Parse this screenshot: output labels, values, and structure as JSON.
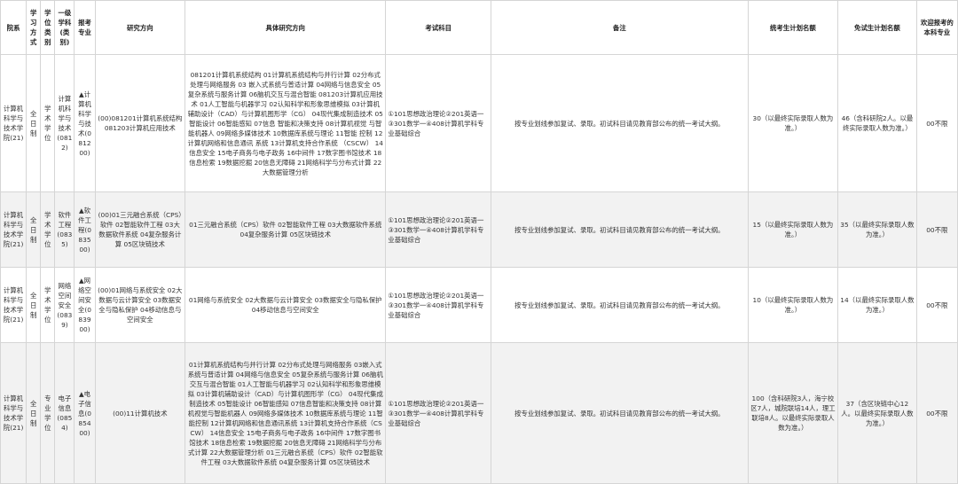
{
  "headers": {
    "dept": "院系",
    "study_mode": "学习方式",
    "degree_type": "学位类别",
    "first_discipline": "一级学科(类别)",
    "major": "报考专业",
    "direction": "研究方向",
    "specific_direction": "具体研究方向",
    "exam_subjects": "考试科目",
    "remarks": "备注",
    "unified_plan": "统考生计划名额",
    "exempt_plan": "免试生计划名额",
    "welcome": "欢迎报考的本科专业"
  },
  "rows": [
    {
      "dept": "计算机科学与技术学院(21)",
      "study_mode": "全日制",
      "degree_type": "学术学位",
      "first_discipline": "计算机科学与技术(0812)",
      "major": "▲计算机科学与技术(081200)",
      "direction": "(00)081201计算机系统结构 081203计算机应用技术",
      "specific_direction": "081201计算机系统结构 01计算机系统结构与并行计算 02分布式处理与网络服务 03 嵌入式系统与普适计算 04网络与信息安全 05复杂系统与服务计算 06脑机交互与混合智能 081203计算机应用技术 01人工智能与机器学习 02认知科学和形象思维模拟 03计算机 辅助设计（CAD）与计算机图形学（CG） 04现代集成制造技术 05智能设计 06智能感知 07信息 智能和决策支持 08计算机视觉 与智能机器人 09网络多媒体技术 10数据库系统与理论 11智能 控制 12计算机网络和信息通讯 系统 13计算机支持合作系统 （CSCW） 14信息安全 15电子商务与电子政务 16中间件 17数字图书馆技术 18信息检索 19数据挖掘 20信息无障碍 21网络科学与分布式计算 22大数据管理分析",
      "exam_subjects": "①101思想政治理论②201英语一③301数学一④408计算机学科专业基础综合",
      "remarks": "按专业划线参加复试、录取。初试科目请见教育部公布的统一考试大纲。",
      "unified_plan": "30（以最终实际录取人数为准。）",
      "exempt_plan": "46（含科研院2人。以最终实际录取人数为准。）",
      "welcome": "00不限"
    },
    {
      "dept": "计算机科学与技术学院(21)",
      "study_mode": "全日制",
      "degree_type": "学术学位",
      "first_discipline": "软件工程(0835)",
      "major": "▲软件工程(083500)",
      "direction": "(00)01三元融合系统（CPS）软件 02智能软件工程 03大数据软件系统 04复杂服务计算 05区块链技术",
      "specific_direction": "01三元融合系统（CPS）软件 02智能软件工程 03大数据软件系统 04复杂服务计算 05区块链技术",
      "exam_subjects": "①101思想政治理论②201英语一③301数学一④408计算机学科专业基础综合",
      "remarks": "按专业划线参加复试、录取。初试科目请见教育部公布的统一考试大纲。",
      "unified_plan": "15（以最终实际录取人数为准。）",
      "exempt_plan": "35（以最终实际录取人数为准。）",
      "welcome": "00不限"
    },
    {
      "dept": "计算机科学与技术学院(21)",
      "study_mode": "全日制",
      "degree_type": "学术学位",
      "first_discipline": "网络空间安全(0839)",
      "major": "▲网络空间安全(083900)",
      "direction": "(00)01网络与系统安全 02大数据与云计算安全 03数据安全与隐私保护 04移动信息与空间安全",
      "specific_direction": "01网络与系统安全 02大数据与云计算安全 03数据安全与隐私保护 04移动信息与空间安全",
      "exam_subjects": "①101思想政治理论②201英语一③301数学一④408计算机学科专业基础综合",
      "remarks": "按专业划线参加复试、录取。初试科目请见教育部公布的统一考试大纲。",
      "unified_plan": "10（以最终实际录取人数为准。）",
      "exempt_plan": "14（以最终实际录取人数为准。）",
      "welcome": "00不限"
    },
    {
      "dept": "计算机科学与技术学院(21)",
      "study_mode": "全日制",
      "degree_type": "专业学位",
      "first_discipline": "电子信息(0854)",
      "major": "▲电子信息(085400)",
      "direction": "(00)11计算机技术",
      "specific_direction": "01计算机系统结构与并行计算 02分布式处理与网络服务 03嵌入式系统与普适计算 04网络与信息安全 05复杂系统与服务计算 06脑机交互与混合智能 01人工智能与机器学习 02认知科学和形象思维模拟 03计算机辅助设计（CAD）与计算机图形学（CG） 04现代集成制造技术 05智能设计 06智能感知 07信息智能和决策支持 08计算机视觉与智能机器人 09网络多媒体技术 10数据库系统与理论 11智能控制 12计算机网络和信息通讯系统 13计算机支持合作系统（CSCW） 14信息安全 15电子商务与电子政务 16中间件 17数字图书馆技术 18信息检索 19数据挖掘 20信息无障碍 21网络科学与分布式计算 22大数据管理分析 01三元融合系统（CPS）软件 02智能软件工程 03大数据软件系统 04复杂服务计算 05区块链技术",
      "exam_subjects": "①101思想政治理论②201英语一③301数学一④408计算机学科专业基础综合",
      "remarks": "按专业划线参加复试、录取。初试科目请见教育部公布的统一考试大纲。",
      "unified_plan": "100（含科研院3人，海宁校区7人，城院联培14人，理工联培8人。以最终实际录取人数为准。）",
      "exempt_plan": "37（含区块链中心12人。以最终实际录取人数为准。）",
      "welcome": "00不限"
    }
  ]
}
